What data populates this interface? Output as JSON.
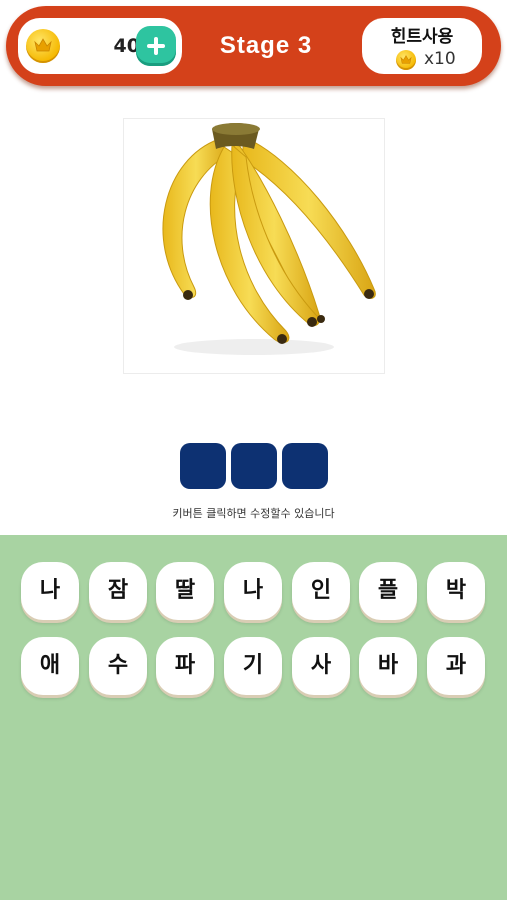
{
  "header": {
    "coins": "40",
    "coin_icon": "crown-coin-icon",
    "add_icon": "plus-icon",
    "stage_title": "Stage 3",
    "hint_label": "힌트사용",
    "hint_cost": "x10"
  },
  "puzzle": {
    "image_subject": "banana-bunch",
    "answer_slot_count": 3,
    "helper_text": "키버튼 클릭하면 수정할수 있습니다"
  },
  "keyboard": {
    "row1": [
      "나",
      "잠",
      "딸",
      "나",
      "인",
      "플",
      "박"
    ],
    "row2": [
      "애",
      "수",
      "파",
      "기",
      "사",
      "바",
      "과"
    ]
  },
  "colors": {
    "header_bg": "#d4411a",
    "add_button": "#2ec4a0",
    "answer_slot": "#0d3172",
    "keyboard_bg": "#a8d3a2"
  }
}
